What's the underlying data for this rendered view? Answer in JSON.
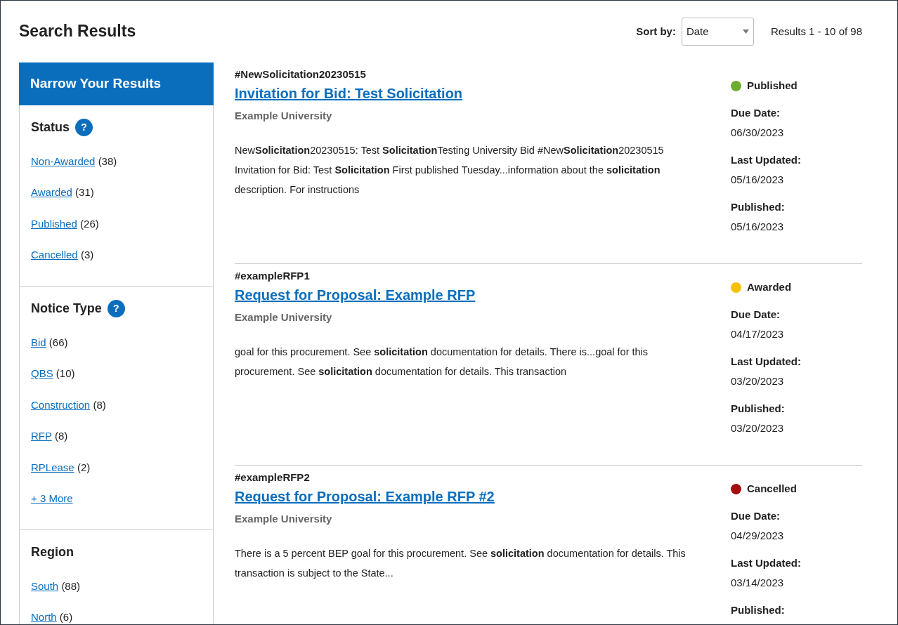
{
  "title": "Search Results",
  "sort": {
    "label": "Sort by:",
    "value": "Date"
  },
  "results_count": "Results 1 - 10 of 98",
  "sidebar": {
    "title": "Narrow Your Results",
    "groups": [
      {
        "title": "Status",
        "help": "?",
        "items": [
          {
            "label": "Non-Awarded",
            "count": "(38)"
          },
          {
            "label": "Awarded",
            "count": "(31)"
          },
          {
            "label": "Published",
            "count": "(26)"
          },
          {
            "label": "Cancelled",
            "count": "(3)"
          }
        ]
      },
      {
        "title": "Notice Type",
        "help": "?",
        "items": [
          {
            "label": "Bid",
            "count": "(66)"
          },
          {
            "label": "QBS",
            "count": "(10)"
          },
          {
            "label": "Construction",
            "count": "(8)"
          },
          {
            "label": "RFP",
            "count": "(8)"
          },
          {
            "label": "RPLease",
            "count": "(2)"
          }
        ],
        "more": "+ 3 More"
      },
      {
        "title": "Region",
        "items": [
          {
            "label": "South",
            "count": "(88)"
          },
          {
            "label": "North",
            "count": "(6)"
          }
        ]
      }
    ]
  },
  "results": [
    {
      "tag": "#NewSolicitation20230515",
      "title": "Invitation for Bid: Test Solicitation",
      "org": "Example University",
      "snippet": "New**Solicitation**20230515: Test **Solicitation**Testing University Bid #New**Solicitation**20230515 Invitation for Bid: Test **Solicitation** First published Tuesday...information about the **solicitation** description. For instructions",
      "status": "Published",
      "color": "#6aad2f",
      "meta": [
        {
          "label": "Due Date:",
          "value": "06/30/2023"
        },
        {
          "label": "Last Updated:",
          "value": "05/16/2023"
        },
        {
          "label": "Published:",
          "value": "05/16/2023"
        }
      ]
    },
    {
      "tag": "#exampleRFP1",
      "title": "Request for Proposal: Example RFP",
      "org": "Example University",
      "snippet": "goal for this procurement. See **solicitation** documentation for details. There is...goal for this procurement. See **solicitation** documentation for details. This transaction",
      "status": "Awarded",
      "color": "#f5c000",
      "meta": [
        {
          "label": "Due Date:",
          "value": "04/17/2023"
        },
        {
          "label": "Last Updated:",
          "value": "03/20/2023"
        },
        {
          "label": "Published:",
          "value": "03/20/2023"
        }
      ]
    },
    {
      "tag": "#exampleRFP2",
      "title": "Request for Proposal: Example RFP #2",
      "org": "Example University",
      "snippet": "There is a 5 percent BEP goal for this procurement. See **solicitation** documentation for details. This transaction is subject to the State...",
      "status": "Cancelled",
      "color": "#a50e0e",
      "meta": [
        {
          "label": "Due Date:",
          "value": "04/29/2023"
        },
        {
          "label": "Last Updated:",
          "value": "03/14/2023"
        },
        {
          "label": "Published:"
        }
      ]
    }
  ]
}
